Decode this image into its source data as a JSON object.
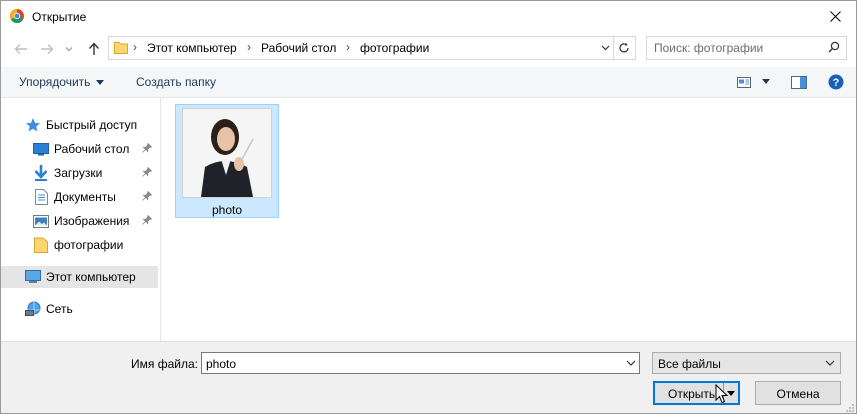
{
  "window": {
    "title": "Открытие"
  },
  "address": {
    "crumbs": [
      "Этот компьютер",
      "Рабочий стол",
      "фотографии"
    ]
  },
  "search": {
    "placeholder": "Поиск: фотографии"
  },
  "toolbar": {
    "organize_label": "Упорядочить",
    "new_folder_label": "Создать папку"
  },
  "sidebar": {
    "items": [
      {
        "label": "Быстрый доступ",
        "icon": "star-icon"
      },
      {
        "label": "Рабочий стол",
        "icon": "desktop-icon",
        "pinned": true
      },
      {
        "label": "Загрузки",
        "icon": "download-arrow-icon",
        "pinned": true
      },
      {
        "label": "Документы",
        "icon": "document-icon",
        "pinned": true
      },
      {
        "label": "Изображения",
        "icon": "picture-icon",
        "pinned": true
      },
      {
        "label": "фотографии",
        "icon": "folder-icon"
      },
      {
        "label": "Этот компьютер",
        "icon": "computer-icon",
        "selected": true
      },
      {
        "label": "Сеть",
        "icon": "network-icon"
      }
    ]
  },
  "files": [
    {
      "name": "photo",
      "selected": true
    }
  ],
  "bottom": {
    "filename_label": "Имя файла:",
    "filename_value": "photo",
    "filetype_value": "Все файлы",
    "open_label": "Открыть",
    "cancel_label": "Отмена"
  },
  "colors": {
    "accent": "#0078d7",
    "selection_bg": "#cce8ff",
    "selection_border": "#99d1ff",
    "toolbar_text": "#1e395b",
    "folder_yellow": "#ffd66b"
  }
}
